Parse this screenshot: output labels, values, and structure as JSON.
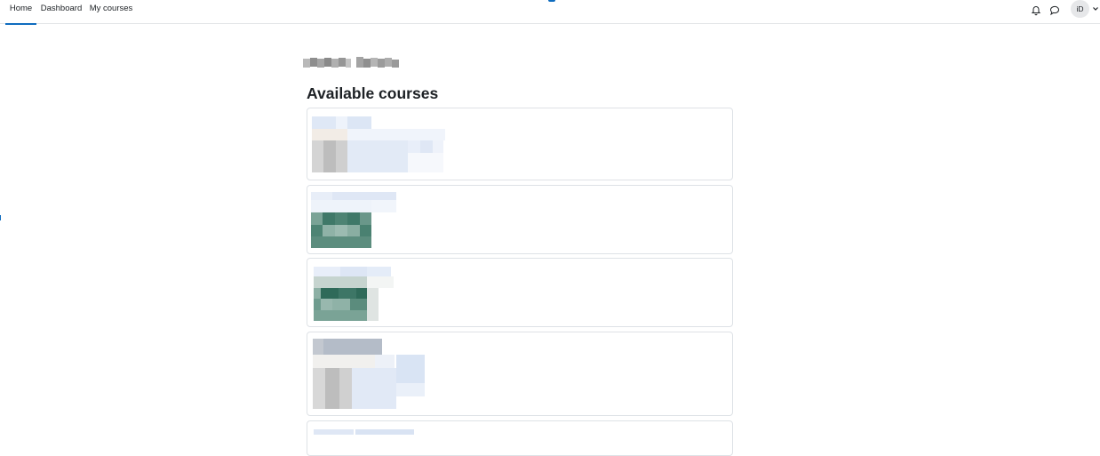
{
  "navbar": {
    "tabs": [
      {
        "label": "Home",
        "active": true
      },
      {
        "label": "Dashboard",
        "active": false
      },
      {
        "label": "My courses",
        "active": false
      }
    ],
    "icons": [
      "bell-icon",
      "message-icon",
      "chevron-down-icon"
    ],
    "user_initials": "iD"
  },
  "main": {
    "section_title": "Available courses",
    "course_count_visible": 5
  },
  "colors": {
    "accent": "#0f6cbf",
    "border": "#dee2e6",
    "blur_blue": "#e3ebf7",
    "blur_gray": "#c8c8c8",
    "course_image_green": "#3f7868"
  }
}
